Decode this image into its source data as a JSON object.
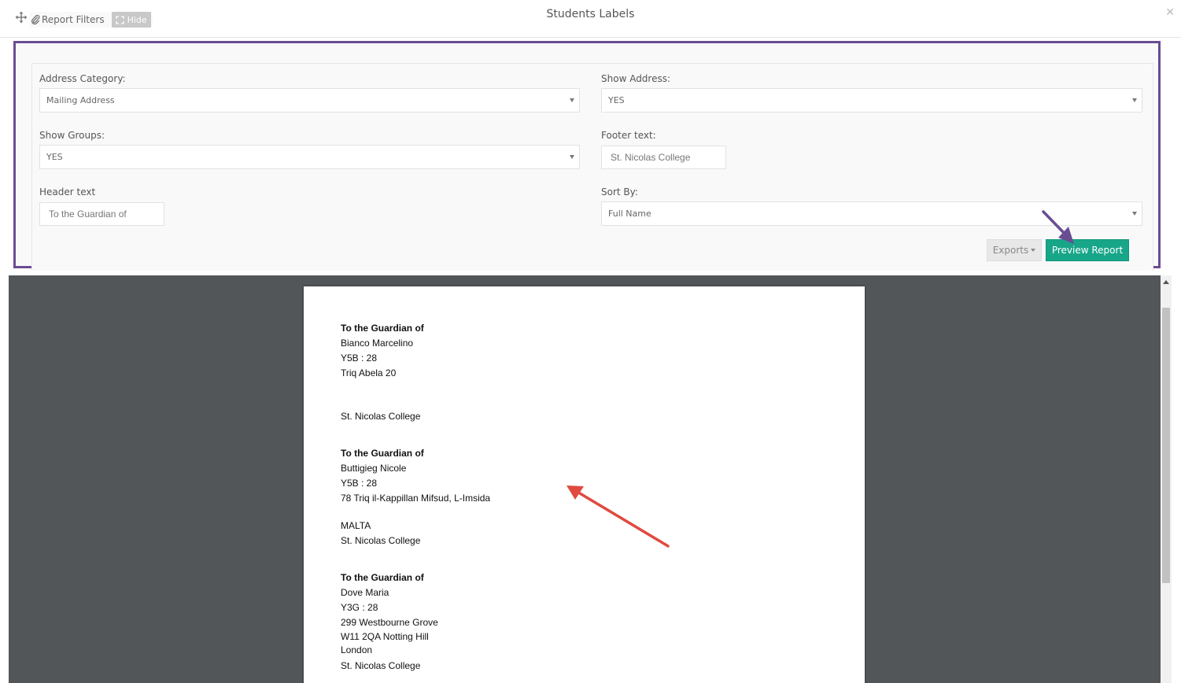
{
  "window": {
    "title": "Students Labels"
  },
  "filters": {
    "legend": "Report Filters",
    "hide_label": "Hide",
    "address_category": {
      "label": "Address Category:",
      "value": "Mailing Address"
    },
    "show_address": {
      "label": "Show Address:",
      "value": "YES"
    },
    "show_groups": {
      "label": "Show Groups:",
      "value": "YES"
    },
    "footer_text": {
      "label": "Footer text:",
      "value": "St. Nicolas College"
    },
    "header_text": {
      "label": "Header text",
      "value": "To the Guardian of"
    },
    "sort_by": {
      "label": "Sort By:",
      "value": "Full Name"
    }
  },
  "actions": {
    "exports_label": "Exports",
    "preview_label": "Preview Report"
  },
  "preview": {
    "labels": [
      {
        "header": "To the Guardian of",
        "name": "Bianco Marcelino",
        "group": "Y5B : 28",
        "address_1": "Triq Abela 20",
        "footer": "St. Nicolas College"
      },
      {
        "header": "To the Guardian of",
        "name": "Buttigieg Nicole",
        "group": "Y5B : 28",
        "address_1": "78 Triq il-Kappillan Mifsud, L-Imsida",
        "country": "MALTA",
        "footer": "St. Nicolas College"
      },
      {
        "header": "To the Guardian of",
        "name": "Dove Maria",
        "group": "Y3G : 28",
        "address_1": "299 Westbourne Grove",
        "address_2": "W11 2QA  Notting Hill",
        "address_3": "London",
        "footer": "St. Nicolas College"
      }
    ]
  },
  "annotations": {
    "purple_arrow_color": "#6a4c93",
    "red_arrow_color": "#e04a3f",
    "accent_color": "#18a689"
  }
}
